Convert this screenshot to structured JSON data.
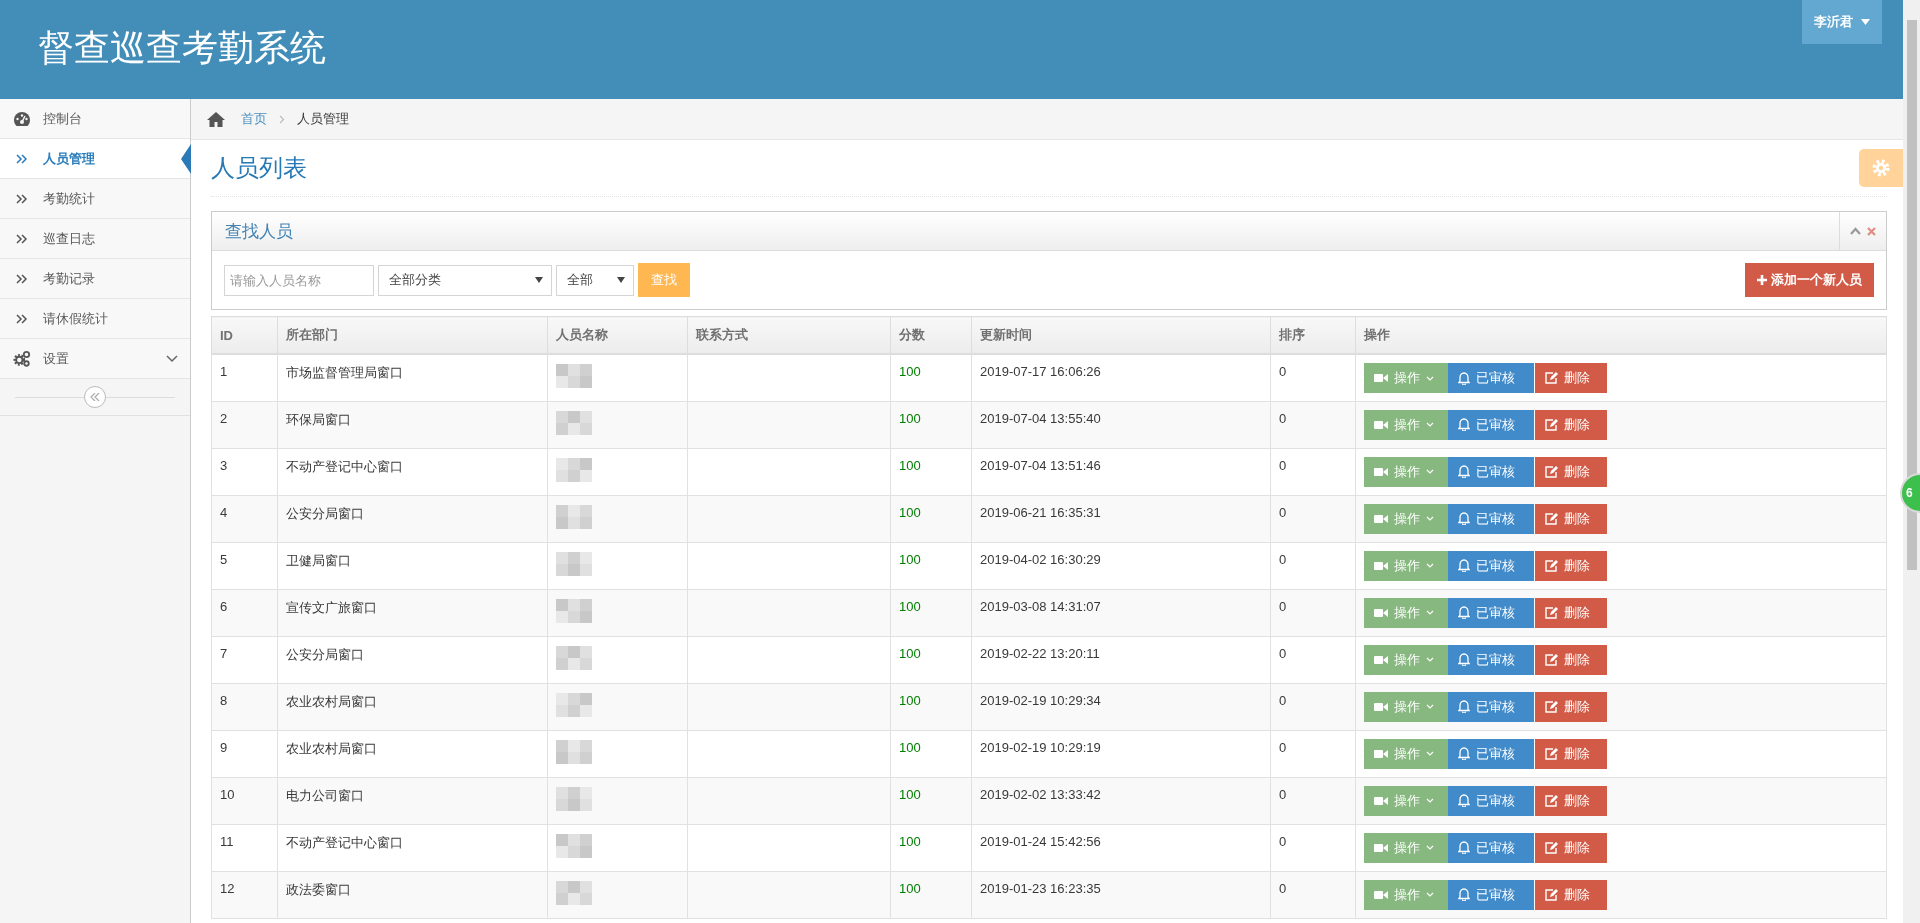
{
  "header": {
    "title": "督查巡查考勤系统",
    "user": "李沂君"
  },
  "sidebar": {
    "items": [
      {
        "label": "控制台",
        "kind": "dashboard",
        "selected": false,
        "expandable": false
      },
      {
        "label": "人员管理",
        "kind": "link",
        "selected": true,
        "expandable": false
      },
      {
        "label": "考勤统计",
        "kind": "link",
        "selected": false,
        "expandable": false
      },
      {
        "label": "巡查日志",
        "kind": "link",
        "selected": false,
        "expandable": false
      },
      {
        "label": "考勤记录",
        "kind": "link",
        "selected": false,
        "expandable": false
      },
      {
        "label": "请休假统计",
        "kind": "link",
        "selected": false,
        "expandable": false
      },
      {
        "label": "设置",
        "kind": "settings",
        "selected": false,
        "expandable": true
      }
    ]
  },
  "breadcrumb": [
    {
      "label": "首页",
      "kind": "link"
    },
    {
      "label": "人员管理",
      "kind": "current"
    }
  ],
  "page_title": "人员列表",
  "search_panel": {
    "title": "查找人员",
    "name_field": {
      "placeholder": "请输入人员名称"
    },
    "category_select": "全部分类",
    "status_select": "全部",
    "search_button": "查找",
    "add_button": "添加一个新人员"
  },
  "table": {
    "columns": [
      "ID",
      "所在部门",
      "人员名称",
      "联系方式",
      "分数",
      "更新时间",
      "排序",
      "操作"
    ],
    "rows": [
      {
        "id": "1",
        "department": "市场监督管理局窗口",
        "score": "100",
        "updated": "2019-07-17 16:06:26",
        "sort": "0",
        "actions": [
          "操作",
          "已审核",
          "删除"
        ]
      },
      {
        "id": "2",
        "department": "环保局窗口",
        "score": "100",
        "updated": "2019-07-04 13:55:40",
        "sort": "0",
        "actions": [
          "操作",
          "已审核",
          "删除"
        ]
      },
      {
        "id": "3",
        "department": "不动产登记中心窗口",
        "score": "100",
        "updated": "2019-07-04 13:51:46",
        "sort": "0",
        "actions": [
          "操作",
          "已审核",
          "删除"
        ]
      },
      {
        "id": "4",
        "department": "公安分局窗口",
        "score": "100",
        "updated": "2019-06-21 16:35:31",
        "sort": "0",
        "actions": [
          "操作",
          "已审核",
          "删除"
        ]
      },
      {
        "id": "5",
        "department": "卫健局窗口",
        "score": "100",
        "updated": "2019-04-02 16:30:29",
        "sort": "0",
        "actions": [
          "操作",
          "已审核",
          "删除"
        ]
      },
      {
        "id": "6",
        "department": "宣传文广旅窗口",
        "score": "100",
        "updated": "2019-03-08 14:31:07",
        "sort": "0",
        "actions": [
          "操作",
          "已审核",
          "删除"
        ]
      },
      {
        "id": "7",
        "department": "公安分局窗口",
        "score": "100",
        "updated": "2019-02-22 13:20:11",
        "sort": "0",
        "actions": [
          "操作",
          "已审核",
          "删除"
        ]
      },
      {
        "id": "8",
        "department": "农业农村局窗口",
        "score": "100",
        "updated": "2019-02-19 10:29:34",
        "sort": "0",
        "actions": [
          "操作",
          "已审核",
          "删除"
        ]
      },
      {
        "id": "9",
        "department": "农业农村局窗口",
        "score": "100",
        "updated": "2019-02-19 10:29:19",
        "sort": "0",
        "actions": [
          "操作",
          "已审核",
          "删除"
        ]
      },
      {
        "id": "10",
        "department": "电力公司窗口",
        "score": "100",
        "updated": "2019-02-02 13:33:42",
        "sort": "0",
        "actions": [
          "操作",
          "已审核",
          "删除"
        ]
      },
      {
        "id": "11",
        "department": "不动产登记中心窗口",
        "score": "100",
        "updated": "2019-01-24 15:42:56",
        "sort": "0",
        "actions": [
          "操作",
          "已审核",
          "删除"
        ]
      },
      {
        "id": "12",
        "department": "政法委窗口",
        "score": "100",
        "updated": "2019-01-23 16:23:35",
        "sort": "0",
        "actions": [
          "操作",
          "已审核",
          "删除"
        ]
      }
    ]
  },
  "float_badge": "6"
}
